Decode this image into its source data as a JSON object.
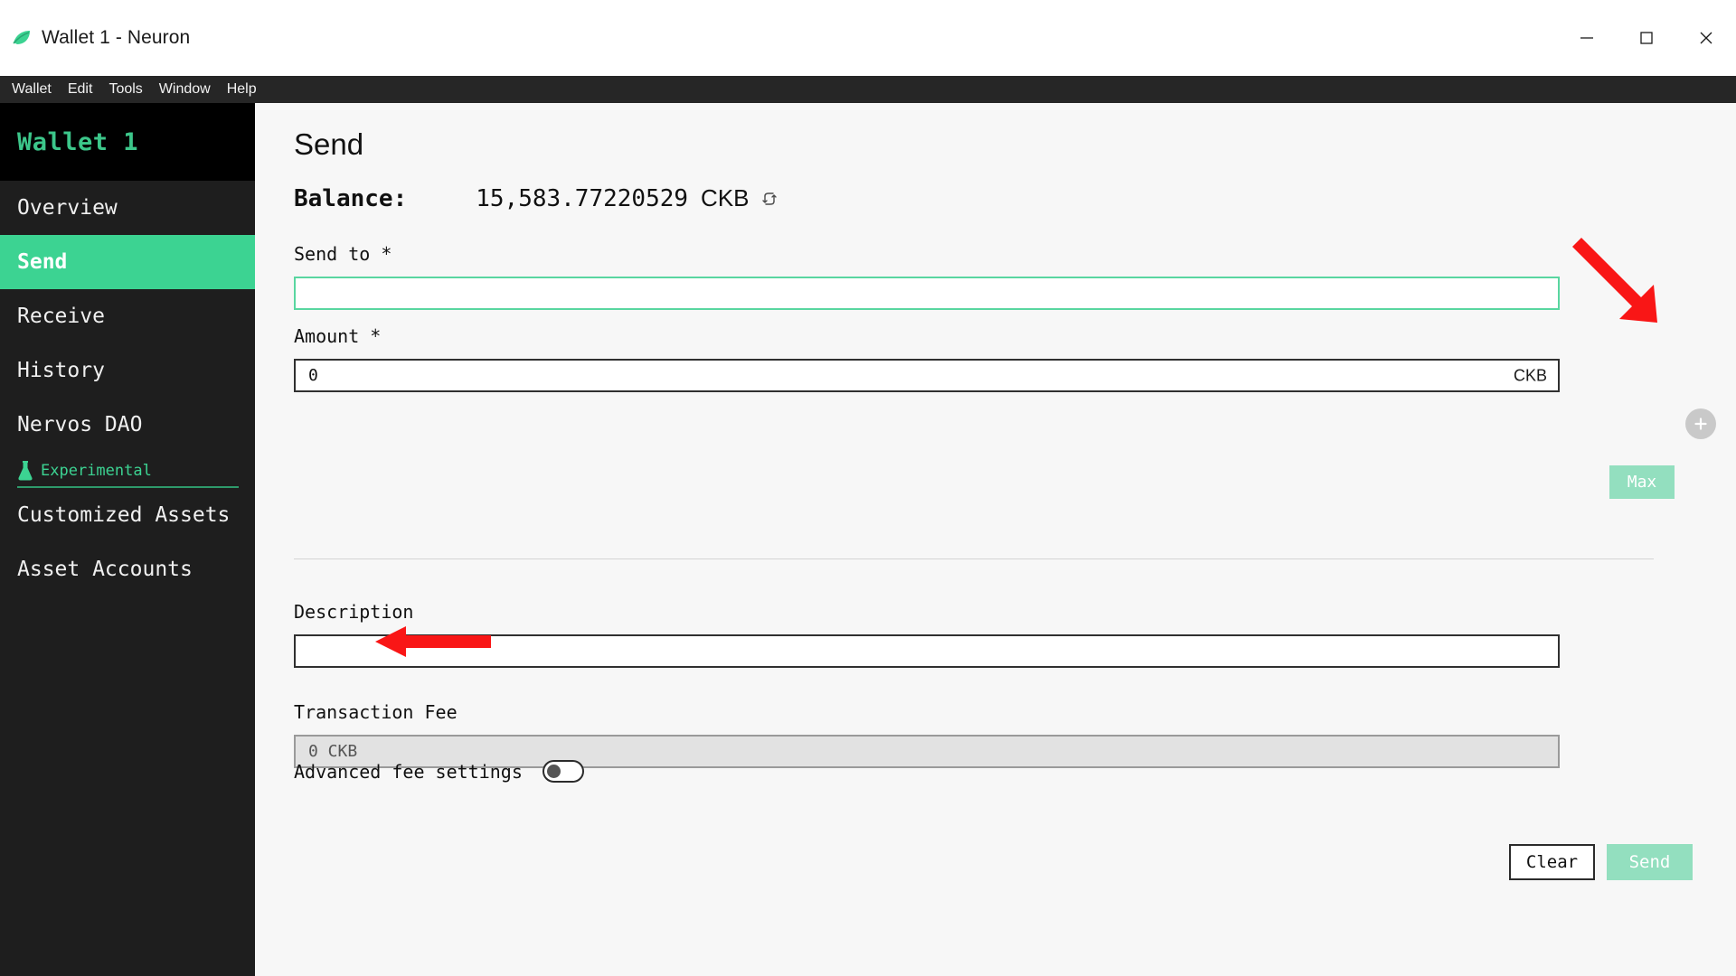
{
  "window": {
    "title": "Wallet 1 - Neuron",
    "logo_icon": "neuron-leaf-logo",
    "controls": {
      "minimize": "minimize-icon",
      "maximize": "maximize-icon",
      "close": "close-icon"
    }
  },
  "menubar": {
    "items": [
      {
        "label": "Wallet"
      },
      {
        "label": "Edit"
      },
      {
        "label": "Tools"
      },
      {
        "label": "Window"
      },
      {
        "label": "Help"
      }
    ]
  },
  "sidebar": {
    "wallet_name": "Wallet 1",
    "items": [
      {
        "label": "Overview",
        "active": false
      },
      {
        "label": "Send",
        "active": true
      },
      {
        "label": "Receive",
        "active": false
      },
      {
        "label": "History",
        "active": false
      },
      {
        "label": "Nervos DAO",
        "active": false
      }
    ],
    "experimental": {
      "label": "Experimental",
      "icon": "flask-icon"
    },
    "experimental_items": [
      {
        "label": "Customized Assets"
      },
      {
        "label": "Asset Accounts"
      }
    ]
  },
  "main": {
    "page_title": "Send",
    "balance": {
      "label": "Balance:",
      "value": "15,583.77220529",
      "unit": "CKB",
      "refresh_icon": "refresh-swap-icon"
    },
    "send_to": {
      "label": "Send to *",
      "value": "",
      "placeholder": ""
    },
    "amount": {
      "label": "Amount *",
      "value": "0",
      "unit": "CKB",
      "max_button": "Max"
    },
    "add_output_button": {
      "icon": "plus-icon",
      "label": "+"
    },
    "description": {
      "label": "Description",
      "value": "",
      "placeholder": ""
    },
    "transaction_fee": {
      "label": "Transaction Fee",
      "value": "0 CKB"
    },
    "advanced_fee_settings": {
      "label": "Advanced fee settings",
      "enabled": false
    },
    "footer": {
      "clear_label": "Clear",
      "send_label": "Send"
    }
  },
  "annotations": [
    {
      "name": "arrow-to-add-button",
      "color": "#f91616"
    },
    {
      "name": "arrow-to-transaction-fee",
      "color": "#f91616"
    }
  ],
  "colors": {
    "accent_green": "#3cd392",
    "accent_green_muted": "#93dfbf",
    "sidebar_bg": "#1e1e1e",
    "wallet_header_bg": "#000000",
    "menubar_bg": "#262626",
    "main_bg": "#f7f7f7",
    "annotation_red": "#f91616"
  }
}
